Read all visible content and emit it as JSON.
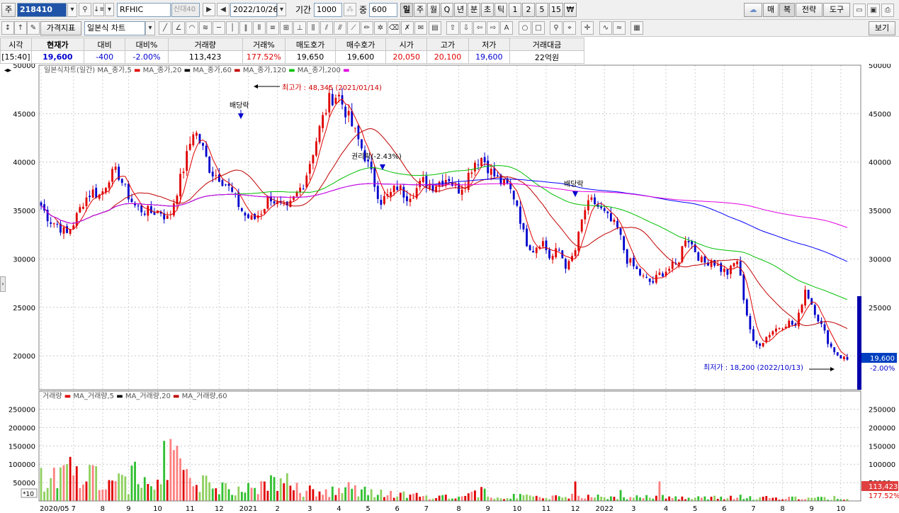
{
  "toolbar": {
    "code_prefix": "주",
    "code": "218410",
    "stock_name": "RFHIC",
    "credit_tags": [
      "신",
      "대",
      "40"
    ],
    "date": "2022/10/26",
    "period_label": "기간",
    "period_value": "1000",
    "count_label": "중",
    "count_value": "600",
    "period_tabs": [
      "일",
      "주",
      "월",
      "Q",
      "년",
      "분",
      "초",
      "틱"
    ],
    "minute_options": [
      "1",
      "2",
      "5",
      "15"
    ],
    "won_icon": "₩",
    "right_buttons": [
      "매",
      "복",
      "전략",
      "도구"
    ],
    "indicator_button": "가격지표",
    "chart_type": "일본식 차트",
    "view_button": "보기"
  },
  "info": {
    "headers": [
      "시각",
      "현재가",
      "대비",
      "대비%",
      "거래량",
      "거래%",
      "매도호가",
      "매수호가",
      "시가",
      "고가",
      "저가",
      "거래대금"
    ],
    "values": [
      "[15:40]",
      "19,600",
      "-400",
      "-2.00%",
      "113,423",
      "177.52%",
      "19,650",
      "19,600",
      "20,050",
      "20,100",
      "19,600",
      "22억원"
    ]
  },
  "price_legend": {
    "title": "일본식차트(일간)",
    "items": [
      "MA_종가,5",
      "MA_종가,20",
      "MA_종가,60",
      "MA_종가,120",
      "MA_종가,200"
    ]
  },
  "volume_legend": {
    "title": "거래량",
    "items": [
      "MA_거래량,5",
      "MA_거래량,20",
      "MA_거래량,60"
    ]
  },
  "annotations": {
    "high": "최고가 : 48,345 (2021/01/14)",
    "low": "최저가 : 18,200 (2022/10/13)",
    "dividend_1": "배당락",
    "rights": "권리락(-2.43%)",
    "dividend_2": "배당락"
  },
  "current_price": {
    "value": "19,600",
    "change": "-2.00%"
  },
  "current_volume": {
    "value": "113,423",
    "ratio": "177.52%"
  },
  "scale_badge": "*10",
  "colors": {
    "up": "#e00000",
    "down": "#0000cc",
    "ma5": "#e00000",
    "ma20": "#000000",
    "ma60": "#c00000",
    "ma120": "#00c000",
    "ma200": "#0000ff",
    "ma_long": "#e000e0"
  },
  "chart_data": {
    "type": "candlestick",
    "price_axis": {
      "ticks": [
        20000,
        25000,
        30000,
        35000,
        40000,
        45000,
        50000
      ],
      "range": [
        16500,
        50000
      ]
    },
    "volume_axis": {
      "ticks": [
        50000,
        100000,
        150000,
        200000,
        250000
      ],
      "range": [
        0,
        280000
      ]
    },
    "x_tick_labels": [
      "2020/05",
      "7",
      "8",
      "9",
      "10",
      "11",
      "12",
      "2021",
      "2",
      "3",
      "4",
      "5",
      "6",
      "7",
      "8",
      "9",
      "10",
      "11",
      "12",
      "2022",
      "3",
      "4",
      "5",
      "6",
      "7",
      "8",
      "9",
      "10"
    ],
    "x_tick_index": [
      0,
      10,
      19,
      27,
      36,
      46,
      55,
      64,
      73,
      83,
      92,
      101,
      110,
      119,
      129,
      138,
      147,
      156,
      165,
      174,
      183,
      193,
      202,
      211,
      220,
      229,
      238,
      247
    ],
    "close_trend": [
      35500,
      34000,
      33500,
      32500,
      34000,
      36000,
      37000,
      36500,
      38500,
      39000,
      37000,
      35500,
      35000,
      34800,
      35000,
      34000,
      37000,
      40000,
      43500,
      41500,
      39000,
      38500,
      37500,
      36000,
      34500,
      34000,
      35000,
      36500,
      35500,
      35000,
      36500,
      38000,
      41000,
      44000,
      46500,
      47000,
      45000,
      43000,
      41000,
      38500,
      36000,
      36500,
      37500,
      36500,
      37000,
      38000,
      37500,
      38000,
      38500,
      37000,
      38000,
      40000,
      40500,
      39000,
      38000,
      37500,
      36000,
      32000,
      31000,
      32000,
      30000,
      31000,
      29000,
      31000,
      35000,
      36000,
      35000,
      34000,
      33000,
      30000,
      29000,
      28000,
      27500,
      28500,
      29000,
      29500,
      32500,
      31000,
      29500,
      30000,
      29000,
      28500,
      30000,
      25000,
      21000,
      21500,
      22500,
      23000,
      23500,
      23000,
      27000,
      25000,
      23000,
      21000,
      20000,
      19600
    ],
    "volume_trend": [
      60000,
      45000,
      80000,
      60000,
      100000,
      90000,
      70000,
      60000,
      55000,
      50000,
      80000,
      70000,
      90000,
      110000,
      95000,
      70000,
      55000,
      45000,
      40000,
      35000,
      30000,
      28000,
      35000,
      48000,
      60000,
      50000,
      40000,
      30000,
      26000,
      25000,
      30000,
      40000,
      35000,
      25000,
      22000,
      20000,
      18000,
      16000,
      15000,
      14000,
      13000,
      13000,
      14000,
      12000,
      15000,
      25000,
      20000,
      14000,
      12000,
      12000,
      11000,
      11000,
      10000,
      10000,
      12000,
      15000,
      13000,
      11000,
      10000,
      10000,
      9000,
      9000,
      10000,
      15000,
      13000,
      11000,
      9000,
      9000,
      9000,
      9000,
      8000,
      9000,
      11000,
      9000,
      8000,
      9000,
      8000,
      10000,
      9000,
      9000,
      8000,
      8000,
      9000,
      8000
    ]
  }
}
